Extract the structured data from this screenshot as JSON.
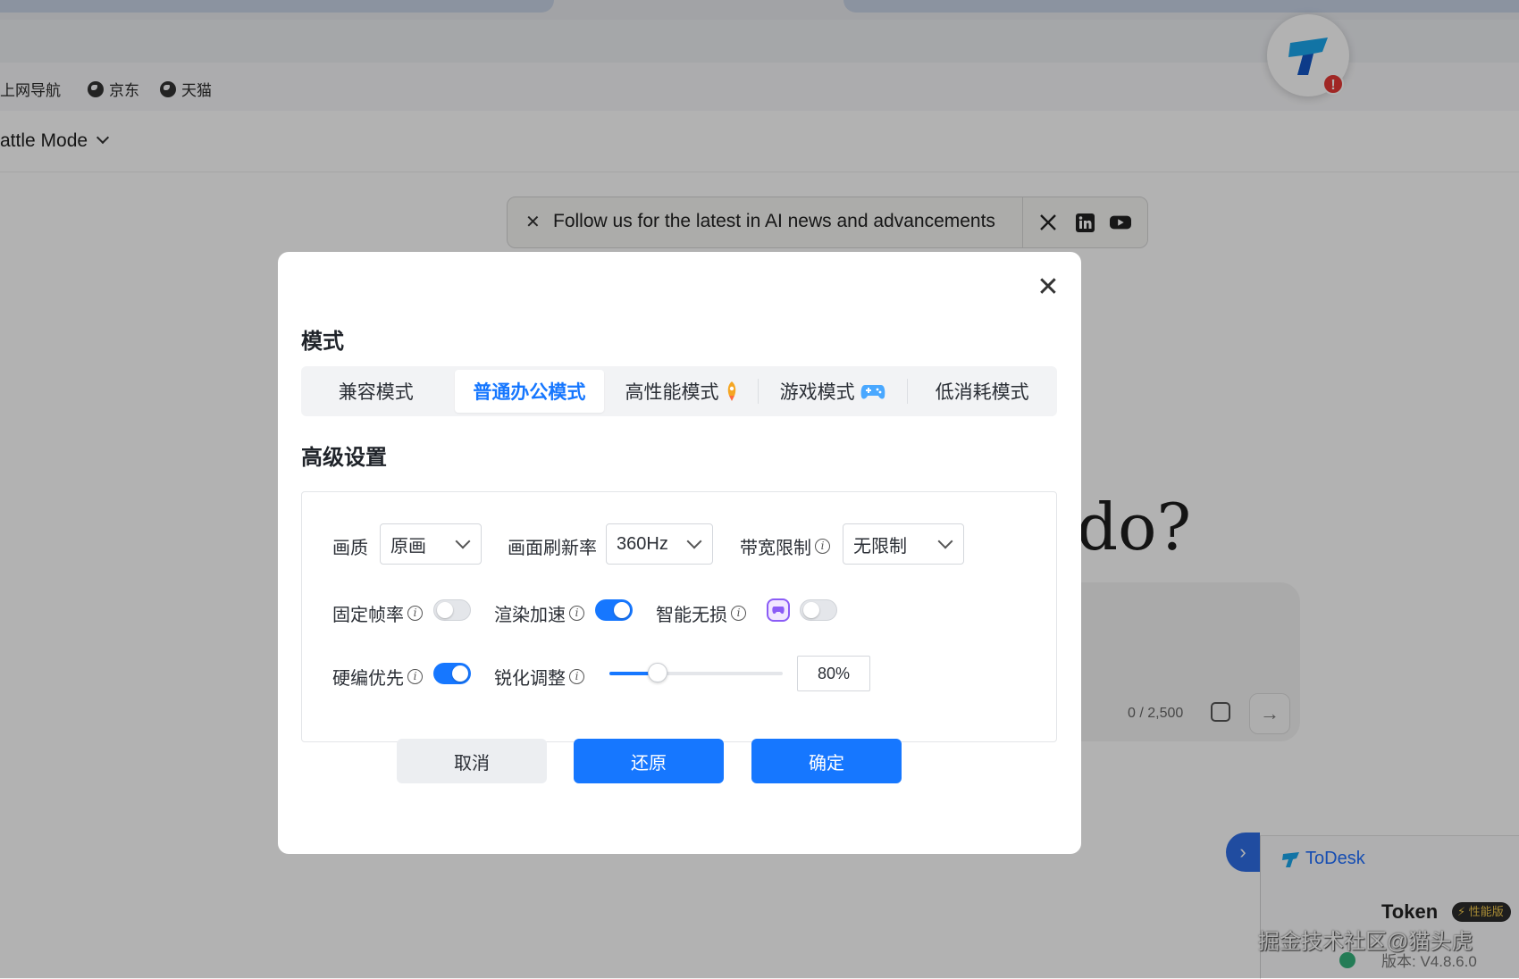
{
  "browser": {
    "bookmarks": [
      "上网导航",
      "京东",
      "天猫"
    ],
    "mode_label": "attle Mode"
  },
  "page": {
    "follow_banner": "Follow us for the latest in AI news and advancements",
    "close_symbol": "✕",
    "social": [
      "x-icon",
      "linkedin-icon",
      "youtube-icon"
    ],
    "headline_fragment": "do?",
    "char_count": "0 / 2,500"
  },
  "todesk": {
    "app_name": "ToDesk",
    "token_label": "Token",
    "perf_badge": "性能版",
    "version": "版本: V4.8.6.0"
  },
  "watermark": "掘金技术社区@猫头虎",
  "dialog": {
    "mode_title": "模式",
    "modes": [
      {
        "label": "兼容模式",
        "icon": ""
      },
      {
        "label": "普通办公模式",
        "icon": ""
      },
      {
        "label": "高性能模式",
        "icon": "rocket-icon"
      },
      {
        "label": "游戏模式",
        "icon": "gamepad-icon"
      },
      {
        "label": "低消耗模式",
        "icon": ""
      }
    ],
    "active_mode": 1,
    "advanced_title": "高级设置",
    "quality_label": "画质",
    "quality_value": "原画",
    "refresh_label": "画面刷新率",
    "refresh_value": "360Hz",
    "bandwidth_label": "带宽限制",
    "bandwidth_value": "无限制",
    "fixed_fps_label": "固定帧率",
    "fixed_fps_on": false,
    "render_accel_label": "渲染加速",
    "render_accel_on": true,
    "smart_lossless_label": "智能无损",
    "smart_lossless_on": false,
    "hw_encode_label": "硬编优先",
    "hw_encode_on": true,
    "sharpen_label": "锐化调整",
    "sharpen_value": 0.28,
    "sharpen_text": "80%",
    "cancel_label": "取消",
    "restore_label": "还原",
    "confirm_label": "确定",
    "accent_color": "#1677ff"
  }
}
